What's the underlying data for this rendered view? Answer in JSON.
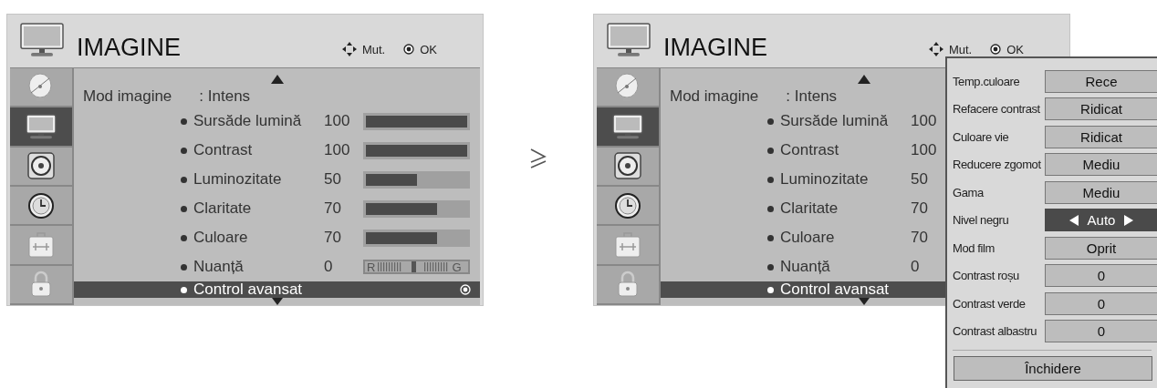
{
  "panels": [
    {
      "title": "IMAGINE",
      "hints": [
        {
          "kind": "move",
          "label": "Mut."
        },
        {
          "kind": "ok",
          "label": "OK"
        }
      ],
      "sidebar": [
        {
          "selected": false
        },
        {
          "selected": true
        },
        {
          "selected": false
        },
        {
          "selected": false
        },
        {
          "selected": false
        },
        {
          "selected": false
        }
      ],
      "mode": {
        "label": "Mod imagine",
        "value": ": Intens"
      },
      "settings": [
        {
          "label": "Sursăde lumină",
          "value": "100",
          "kind": "bar",
          "level": 1
        },
        {
          "label": "Contrast",
          "value": "100",
          "kind": "bar",
          "level": 1
        },
        {
          "label": "Luminozitate",
          "value": "50",
          "kind": "bar",
          "level": 0.5
        },
        {
          "label": "Claritate",
          "value": "70",
          "kind": "bar",
          "level": 0.7
        },
        {
          "label": "Culoare",
          "value": "70",
          "kind": "bar",
          "level": 0.7
        },
        {
          "label": "Nuanță",
          "value": "0",
          "kind": "tint",
          "level": 0.5,
          "left_label": "R",
          "right_label": "G"
        }
      ],
      "advanced": {
        "label": "Control avansat",
        "selected": true,
        "ok_icon": true
      }
    },
    {
      "title": "IMAGINE",
      "hints": [
        {
          "kind": "move",
          "label": "Mut."
        },
        {
          "kind": "ok",
          "label": "OK"
        }
      ],
      "sidebar": [
        {
          "selected": false
        },
        {
          "selected": true
        },
        {
          "selected": false
        },
        {
          "selected": false
        },
        {
          "selected": false
        },
        {
          "selected": false
        }
      ],
      "mode": {
        "label": "Mod imagine",
        "value": ": Intens"
      },
      "settings": [
        {
          "label": "Sursăde lumină",
          "value": "100"
        },
        {
          "label": "Contrast",
          "value": "100"
        },
        {
          "label": "Luminozitate",
          "value": "50"
        },
        {
          "label": "Claritate",
          "value": "70"
        },
        {
          "label": "Culoare",
          "value": "70"
        },
        {
          "label": "Nuanță",
          "value": "0"
        }
      ],
      "advanced": {
        "label": "Control avansat",
        "selected": true,
        "ok_icon": false
      }
    }
  ],
  "advanced_menu": {
    "items": [
      {
        "label": "Temp.culoare",
        "value": "Rece",
        "selected": false
      },
      {
        "label": "Refacere contrast",
        "value": "Ridicat",
        "selected": false
      },
      {
        "label": "Culoare vie",
        "value": "Ridicat",
        "selected": false
      },
      {
        "label": "Reducere zgomot",
        "value": "Mediu",
        "selected": false
      },
      {
        "label": "Gama",
        "value": "Mediu",
        "selected": false
      },
      {
        "label": "Nivel negru",
        "value": "Auto",
        "selected": true
      },
      {
        "label": "Mod film",
        "value": "Oprit",
        "selected": false
      },
      {
        "label": "Contrast roșu",
        "value": "0",
        "selected": false
      },
      {
        "label": "Contrast verde",
        "value": "0",
        "selected": false
      },
      {
        "label": "Contrast albastru",
        "value": "0",
        "selected": false
      }
    ],
    "close": "Închidere"
  }
}
